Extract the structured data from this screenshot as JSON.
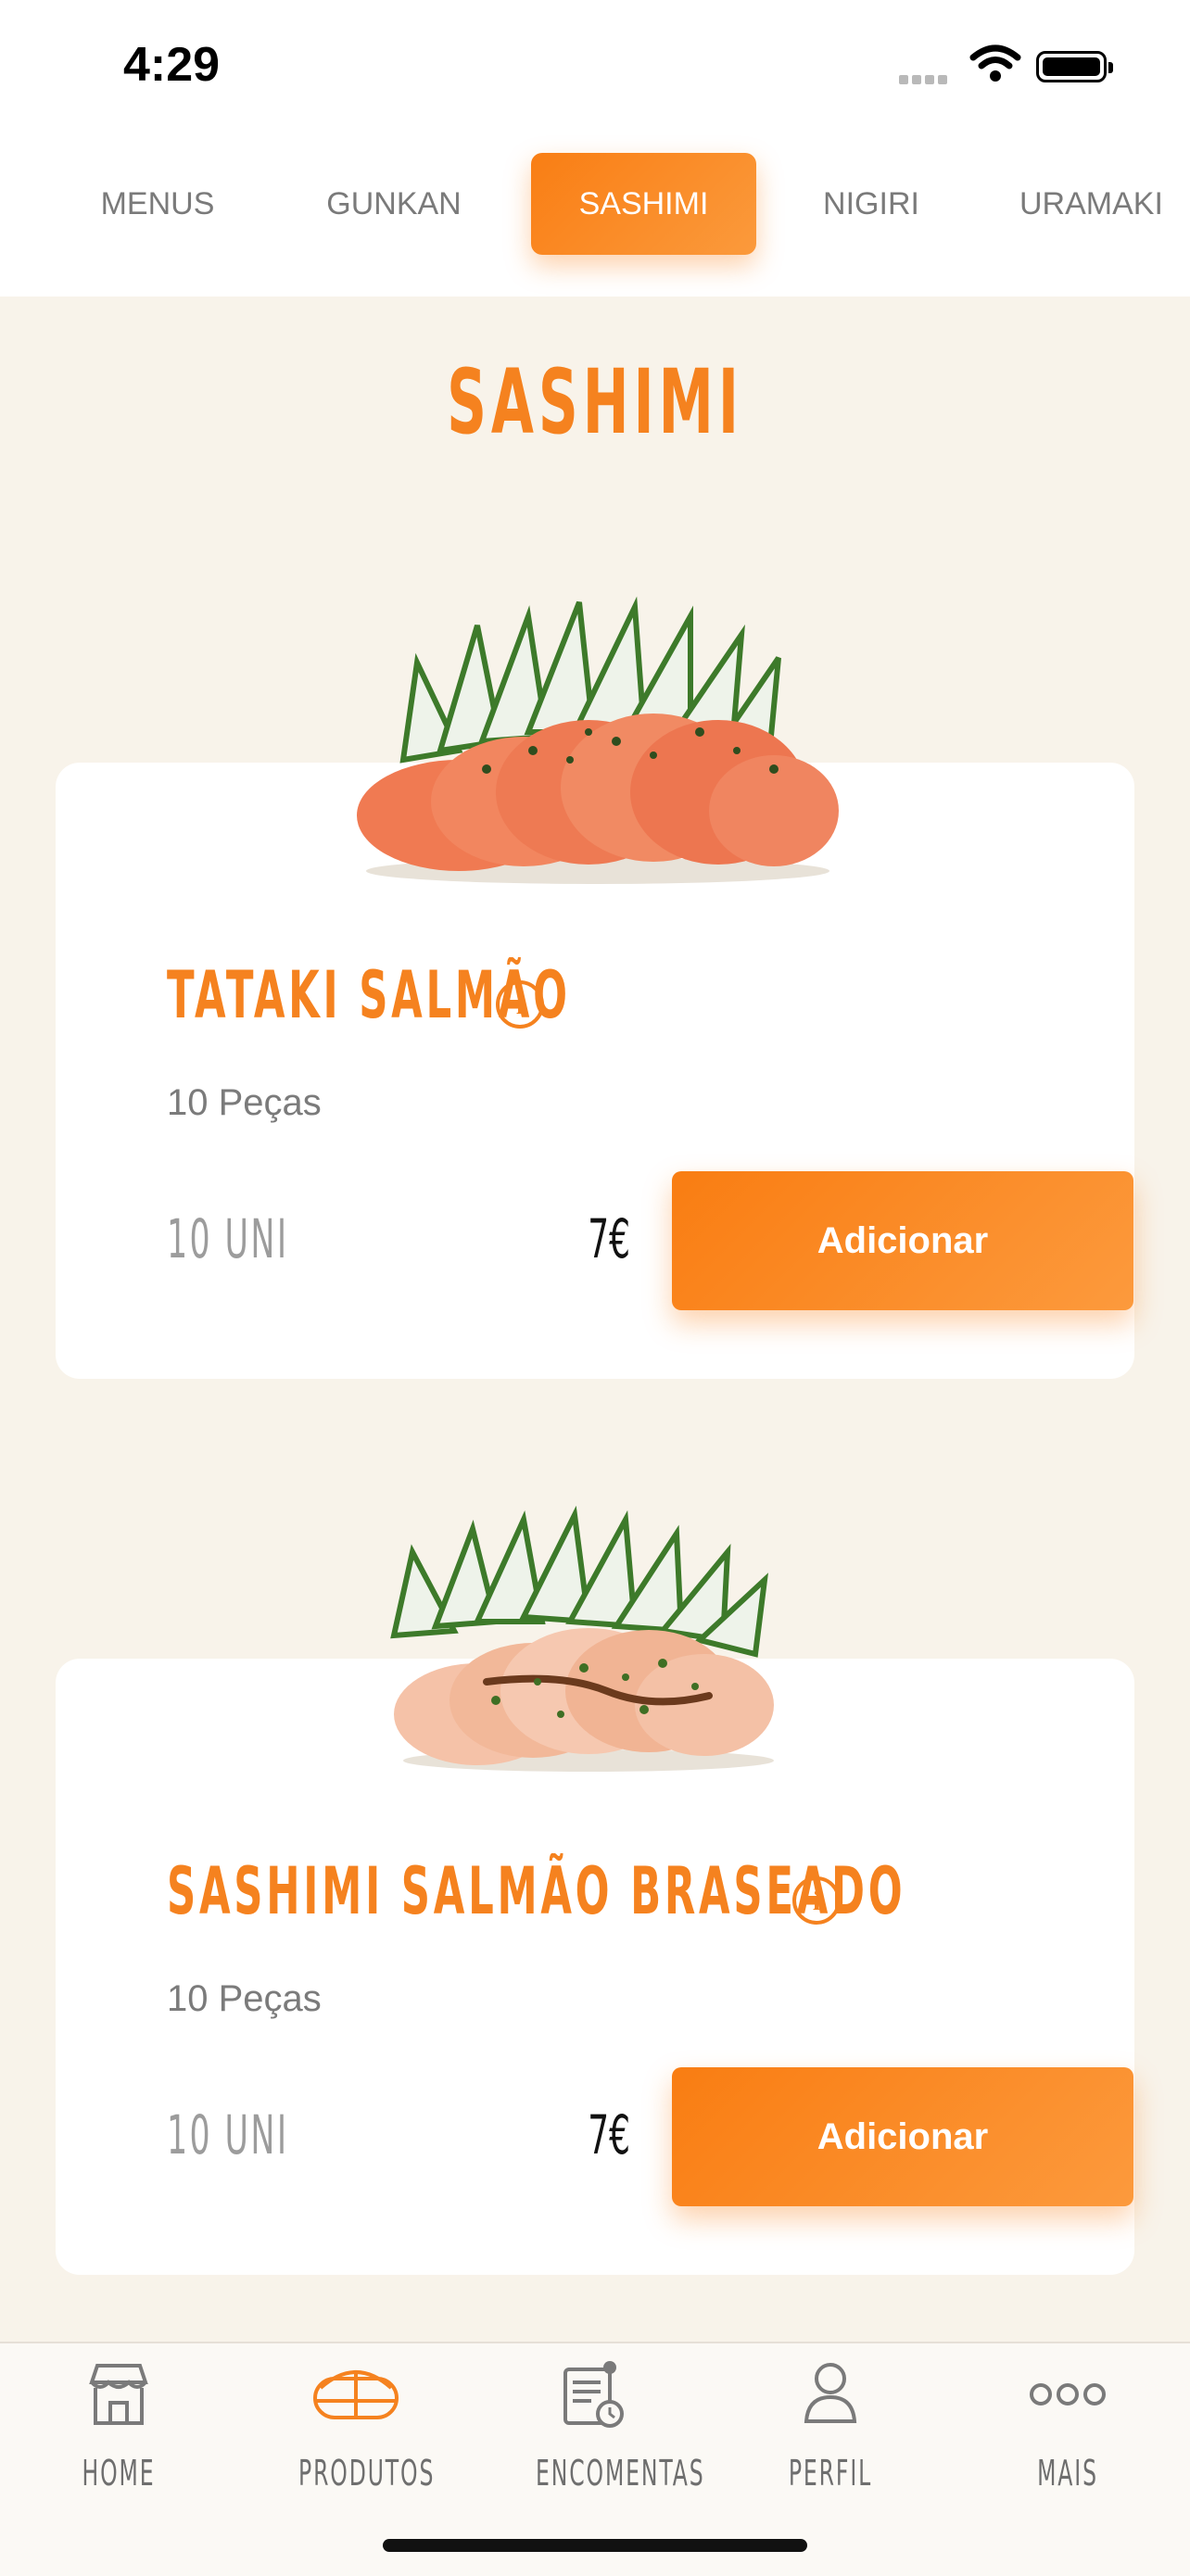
{
  "status_bar": {
    "time": "4:29"
  },
  "category_tabs": [
    "MENUS",
    "GUNKAN",
    "SASHIMI",
    "NIGIRI",
    "URAMAKI"
  ],
  "active_tab": "SASHIMI",
  "page_title": "SASHIMI",
  "products": [
    {
      "name": "TATAKI SALMÃO",
      "pieces": "10 Peças",
      "unit": "10 UNI",
      "price": "7€",
      "button": "Adicionar",
      "image": "salmon-tataki-plate"
    },
    {
      "name": "SASHIMI SALMÃO BRASEADO",
      "pieces": "10 Peças",
      "unit": "10 UNI",
      "price": "7€",
      "button": "Adicionar",
      "image": "braised-salmon-sashimi-plate"
    }
  ],
  "bottom_nav": [
    {
      "label": "HOME",
      "icon": "store-icon",
      "active": false
    },
    {
      "label": "PRODUTOS",
      "icon": "sushi-icon",
      "active": true
    },
    {
      "label": "ENCOMENTAS",
      "icon": "orders-icon",
      "active": false
    },
    {
      "label": "PERFIL",
      "icon": "user-icon",
      "active": false
    },
    {
      "label": "MAIS",
      "icon": "more-icon",
      "active": false
    }
  ],
  "colors": {
    "accent": "#f5821f",
    "background": "#f8f3ea"
  }
}
